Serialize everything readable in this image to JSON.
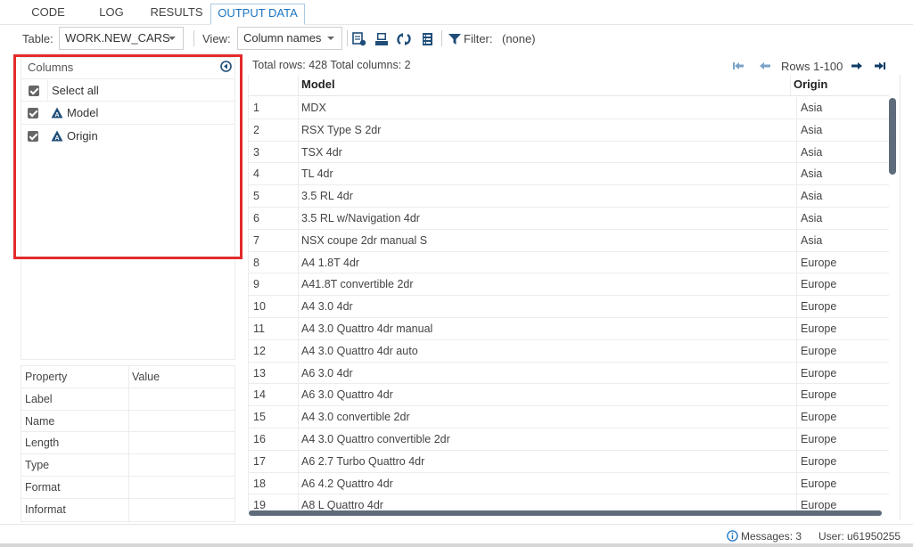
{
  "tabs": [
    {
      "label": "CODE",
      "active": false
    },
    {
      "label": "LOG",
      "active": false
    },
    {
      "label": "RESULTS",
      "active": false
    },
    {
      "label": "OUTPUT DATA",
      "active": true
    }
  ],
  "toolbar": {
    "table_label": "Table:",
    "table_value": "WORK.NEW_CARS",
    "view_label": "View:",
    "view_value": "Column names",
    "icons": [
      "query-icon",
      "print-icon",
      "refresh-icon",
      "columns-list-icon",
      "filter-icon"
    ],
    "filter_label": "Filter:",
    "filter_value": "(none)"
  },
  "columns_panel": {
    "title": "Columns",
    "select_all_label": "Select all",
    "select_all_checked": true,
    "columns": [
      {
        "name": "Model",
        "checked": true,
        "type_icon": "character-type-icon"
      },
      {
        "name": "Origin",
        "checked": true,
        "type_icon": "character-type-icon"
      }
    ]
  },
  "properties": {
    "header": {
      "property": "Property",
      "value": "Value"
    },
    "rows": [
      {
        "property": "Label",
        "value": ""
      },
      {
        "property": "Name",
        "value": ""
      },
      {
        "property": "Length",
        "value": ""
      },
      {
        "property": "Type",
        "value": ""
      },
      {
        "property": "Format",
        "value": ""
      },
      {
        "property": "Informat",
        "value": ""
      }
    ]
  },
  "grid": {
    "summary": "Total rows: 428  Total columns: 2",
    "range_label": "Rows 1-100",
    "columns": [
      "Model",
      "Origin"
    ],
    "rows": [
      {
        "n": "1",
        "model": "MDX",
        "origin": "Asia"
      },
      {
        "n": "2",
        "model": "RSX Type S 2dr",
        "origin": "Asia"
      },
      {
        "n": "3",
        "model": "TSX 4dr",
        "origin": "Asia"
      },
      {
        "n": "4",
        "model": "TL 4dr",
        "origin": "Asia"
      },
      {
        "n": "5",
        "model": "3.5 RL 4dr",
        "origin": "Asia"
      },
      {
        "n": "6",
        "model": "3.5 RL w/Navigation 4dr",
        "origin": "Asia"
      },
      {
        "n": "7",
        "model": "NSX coupe 2dr manual S",
        "origin": "Asia"
      },
      {
        "n": "8",
        "model": "A4 1.8T 4dr",
        "origin": "Europe"
      },
      {
        "n": "9",
        "model": "A41.8T convertible 2dr",
        "origin": "Europe"
      },
      {
        "n": "10",
        "model": "A4 3.0 4dr",
        "origin": "Europe"
      },
      {
        "n": "11",
        "model": "A4 3.0 Quattro 4dr manual",
        "origin": "Europe"
      },
      {
        "n": "12",
        "model": "A4 3.0 Quattro 4dr auto",
        "origin": "Europe"
      },
      {
        "n": "13",
        "model": "A6 3.0 4dr",
        "origin": "Europe"
      },
      {
        "n": "14",
        "model": "A6 3.0 Quattro 4dr",
        "origin": "Europe"
      },
      {
        "n": "15",
        "model": "A4 3.0 convertible 2dr",
        "origin": "Europe"
      },
      {
        "n": "16",
        "model": "A4 3.0 Quattro convertible 2dr",
        "origin": "Europe"
      },
      {
        "n": "17",
        "model": "A6 2.7 Turbo Quattro 4dr",
        "origin": "Europe"
      },
      {
        "n": "18",
        "model": "A6 4.2 Quattro 4dr",
        "origin": "Europe"
      },
      {
        "n": "19",
        "model": "A8 L Quattro 4dr",
        "origin": "Europe"
      }
    ]
  },
  "status": {
    "messages": "Messages: 3",
    "user": "User: u61950255"
  },
  "colors": {
    "accent": "#1a74c4",
    "icon_blue": "#1f4e79",
    "highlight_red": "#e32b2b",
    "scrollbar": "#5e6b7a"
  }
}
